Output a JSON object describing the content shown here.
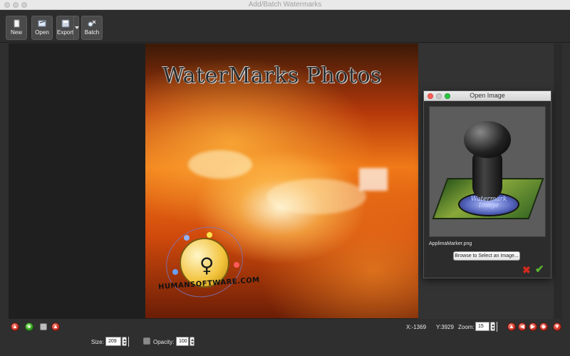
{
  "window": {
    "title": "Add/Batch Watermarks"
  },
  "toolbar": {
    "new_label": "New",
    "open_label": "Open",
    "export_label": "Export",
    "batch_label": "Batch"
  },
  "canvas": {
    "watermark_text": "WaterMarks Photos",
    "logo_text": "HUMANSOFTWARE.COM"
  },
  "dialog": {
    "title": "Open Image",
    "stamp_label_line1": "Watermark",
    "stamp_label_line2": "Image",
    "file_name": "ApplimaMarker.png",
    "browse_label": "Browse to Select an Image..."
  },
  "status": {
    "x_coord": "X:-1369",
    "y_coord": "Y:3929",
    "zoom_label": "Zoom:",
    "zoom_value": "15"
  },
  "settings": {
    "size_label": "Size:",
    "size_value": "209",
    "opacity_label": "Opacity:",
    "opacity_value": "100"
  },
  "colors": {
    "accent_red": "#c42a1c",
    "accent_green": "#2f9a1c",
    "background": "#2f2f2f"
  },
  "icons": [
    "new-icon",
    "open-icon",
    "export-icon",
    "batch-icon",
    "close-icon",
    "check-icon"
  ]
}
